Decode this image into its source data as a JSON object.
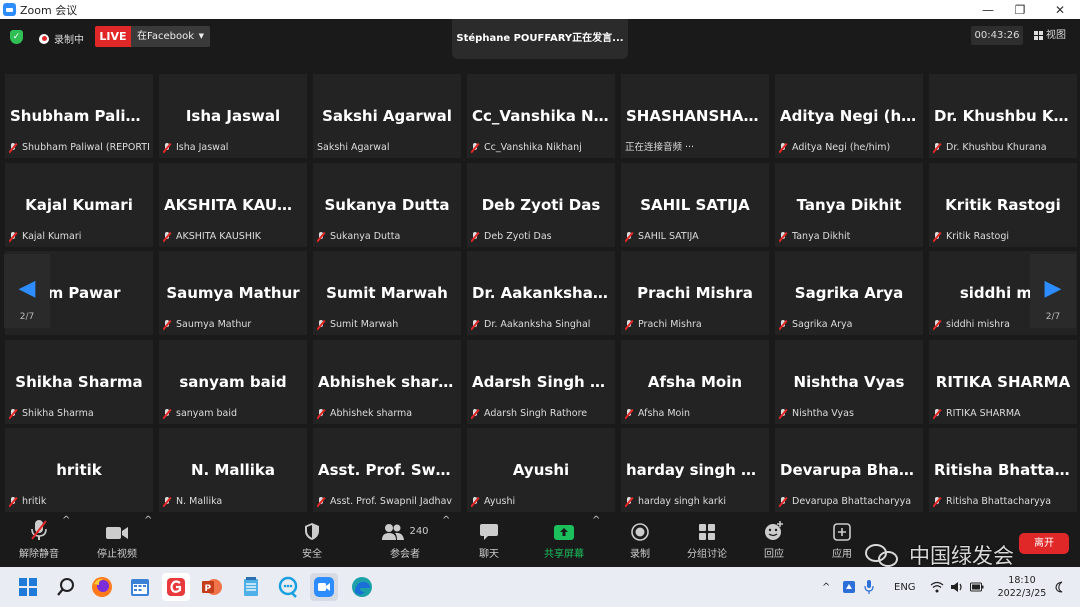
{
  "window": {
    "title": "Zoom 会议",
    "minimize": "—",
    "maximize": "❐",
    "close": "✕"
  },
  "topbar": {
    "recording_label": "录制中",
    "live_label": "LIVE",
    "stream_target": "在Facebook",
    "speaker_text": "Stéphane  POUFFARY正在发言...",
    "timer": "00:43:26",
    "view_label": "视图"
  },
  "pager": {
    "left": "2/7",
    "right": "2/7"
  },
  "participants": [
    {
      "display": "Shubham  Paliw...",
      "name": "Shubham Paliwal (REPORTER)",
      "muted": true
    },
    {
      "display": "Isha Jaswal",
      "name": "Isha Jaswal",
      "muted": true
    },
    {
      "display": "Sakshi Agarwal",
      "name": "Sakshi Agarwal",
      "muted": false
    },
    {
      "display": "Cc_Vanshika  Ni...",
      "name": "Cc_Vanshika Nikhanj",
      "muted": true
    },
    {
      "display": "SHASHANSHAS...",
      "name": "正在连接音频 ···",
      "muted": false
    },
    {
      "display": "Aditya  Negi  (he...",
      "name": "Aditya Negi (he/him)",
      "muted": true
    },
    {
      "display": "Dr. Khushbu  Kh...",
      "name": "Dr. Khushbu Khurana",
      "muted": true
    },
    {
      "display": "Kajal Kumari",
      "name": "Kajal Kumari",
      "muted": true
    },
    {
      "display": "AKSHITA  KAUS...",
      "name": "AKSHITA KAUSHIK",
      "muted": true
    },
    {
      "display": "Sukanya Dutta",
      "name": "Sukanya Dutta",
      "muted": true
    },
    {
      "display": "Deb Zyoti Das",
      "name": "Deb Zyoti Das",
      "muted": true
    },
    {
      "display": "SAHIL SATIJA",
      "name": "SAHIL SATIJA",
      "muted": true
    },
    {
      "display": "Tanya Dikhit",
      "name": "Tanya Dikhit",
      "muted": true
    },
    {
      "display": "Kritik Rastogi",
      "name": "Kritik Rastogi",
      "muted": true
    },
    {
      "display": "am Pawar",
      "name": "Pawar",
      "muted": false
    },
    {
      "display": "Saumya Mathur",
      "name": "Saumya Mathur",
      "muted": true
    },
    {
      "display": "Sumit Marwah",
      "name": "Sumit Marwah",
      "muted": true
    },
    {
      "display": "Dr.  Aakanksha  S...",
      "name": "Dr. Aakanksha Singhal",
      "muted": true
    },
    {
      "display": "Prachi Mishra",
      "name": "Prachi Mishra",
      "muted": true
    },
    {
      "display": "Sagrika Arya",
      "name": "Sagrika Arya",
      "muted": true
    },
    {
      "display": "siddhi mis",
      "name": "siddhi mishra",
      "muted": true
    },
    {
      "display": "Shikha Sharma",
      "name": "Shikha Sharma",
      "muted": true
    },
    {
      "display": "sanyam baid",
      "name": "sanyam baid",
      "muted": true
    },
    {
      "display": "Abhishek sharma",
      "name": "Abhishek sharma",
      "muted": true
    },
    {
      "display": "Adarsh  Singh  R...",
      "name": "Adarsh Singh Rathore",
      "muted": true
    },
    {
      "display": "Afsha Moin",
      "name": "Afsha Moin",
      "muted": true
    },
    {
      "display": "Nishtha Vyas",
      "name": "Nishtha Vyas",
      "muted": true
    },
    {
      "display": "RITIKA SHARMA",
      "name": "RITIKA SHARMA",
      "muted": true
    },
    {
      "display": "hritik",
      "name": "hritik",
      "muted": true
    },
    {
      "display": "N. Mallika",
      "name": "N. Mallika",
      "muted": true
    },
    {
      "display": "Asst.  Prof.  Swap...",
      "name": "Asst. Prof. Swapnil Jadhav",
      "muted": true
    },
    {
      "display": "Ayushi",
      "name": "Ayushi",
      "muted": true
    },
    {
      "display": "harday  singh  ka...",
      "name": "harday singh karki",
      "muted": true
    },
    {
      "display": "Devarupa  Bhatt...",
      "name": "Devarupa Bhattacharyya",
      "muted": true
    },
    {
      "display": "Ritisha  Bhattac...",
      "name": "Ritisha Bhattacharyya",
      "muted": true
    }
  ],
  "toolbar": {
    "unmute": "解除静音",
    "start_video": "停止视频",
    "security": "安全",
    "participants": "参会者",
    "participants_count": "240",
    "chat": "聊天",
    "share_screen": "共享屏幕",
    "record": "录制",
    "breakout": "分组讨论",
    "reactions": "回应",
    "apps": "应用",
    "leave": "离开"
  },
  "watermark": "中国绿发会",
  "taskbar": {
    "lang": "ENG",
    "time": "18:10",
    "date": "2022/3/25"
  },
  "colors": {
    "live": "#e02828",
    "share": "#1bbf5c",
    "accent": "#2d8cff"
  }
}
